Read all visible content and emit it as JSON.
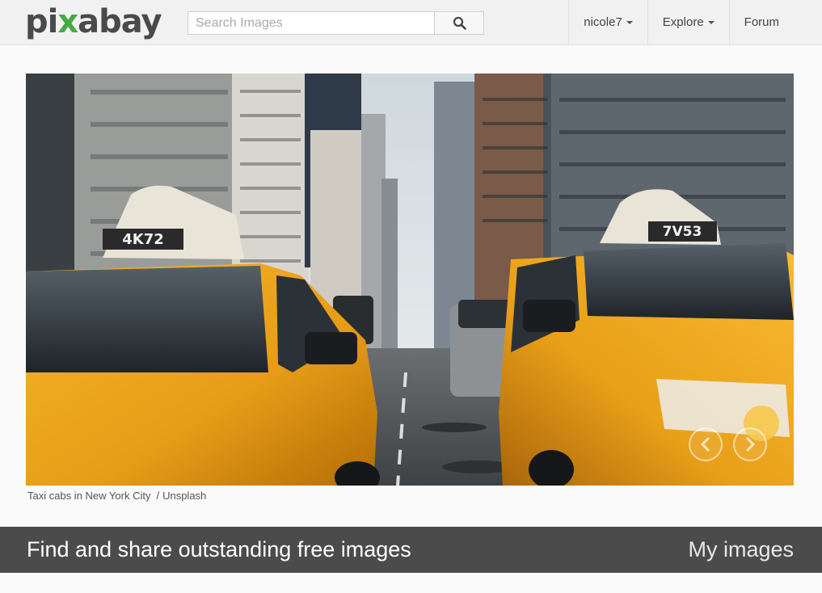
{
  "header": {
    "logo_left": "pi",
    "logo_x": "x",
    "logo_right": "abay",
    "search_placeholder": "Search Images",
    "search_icon": "magnifier-icon",
    "nav": [
      {
        "label": "nicole7",
        "dropdown": true
      },
      {
        "label": "Explore",
        "dropdown": true
      },
      {
        "label": "Forum",
        "dropdown": false
      }
    ]
  },
  "hero": {
    "plate_left": "4K72",
    "plate_right": "7V53",
    "caption_title": "Taxi cabs in New York City",
    "caption_separator": "/",
    "caption_source": "Unsplash",
    "prev_icon": "chevron-left-icon",
    "next_icon": "chevron-right-icon"
  },
  "banner": {
    "title": "Find and share outstanding free images",
    "link": "My images"
  },
  "colors": {
    "logo_gray": "#4a4a4a",
    "logo_green": "#48a947",
    "banner_bg": "#4b4b4b",
    "taxi_yellow": "#f2a81e"
  }
}
